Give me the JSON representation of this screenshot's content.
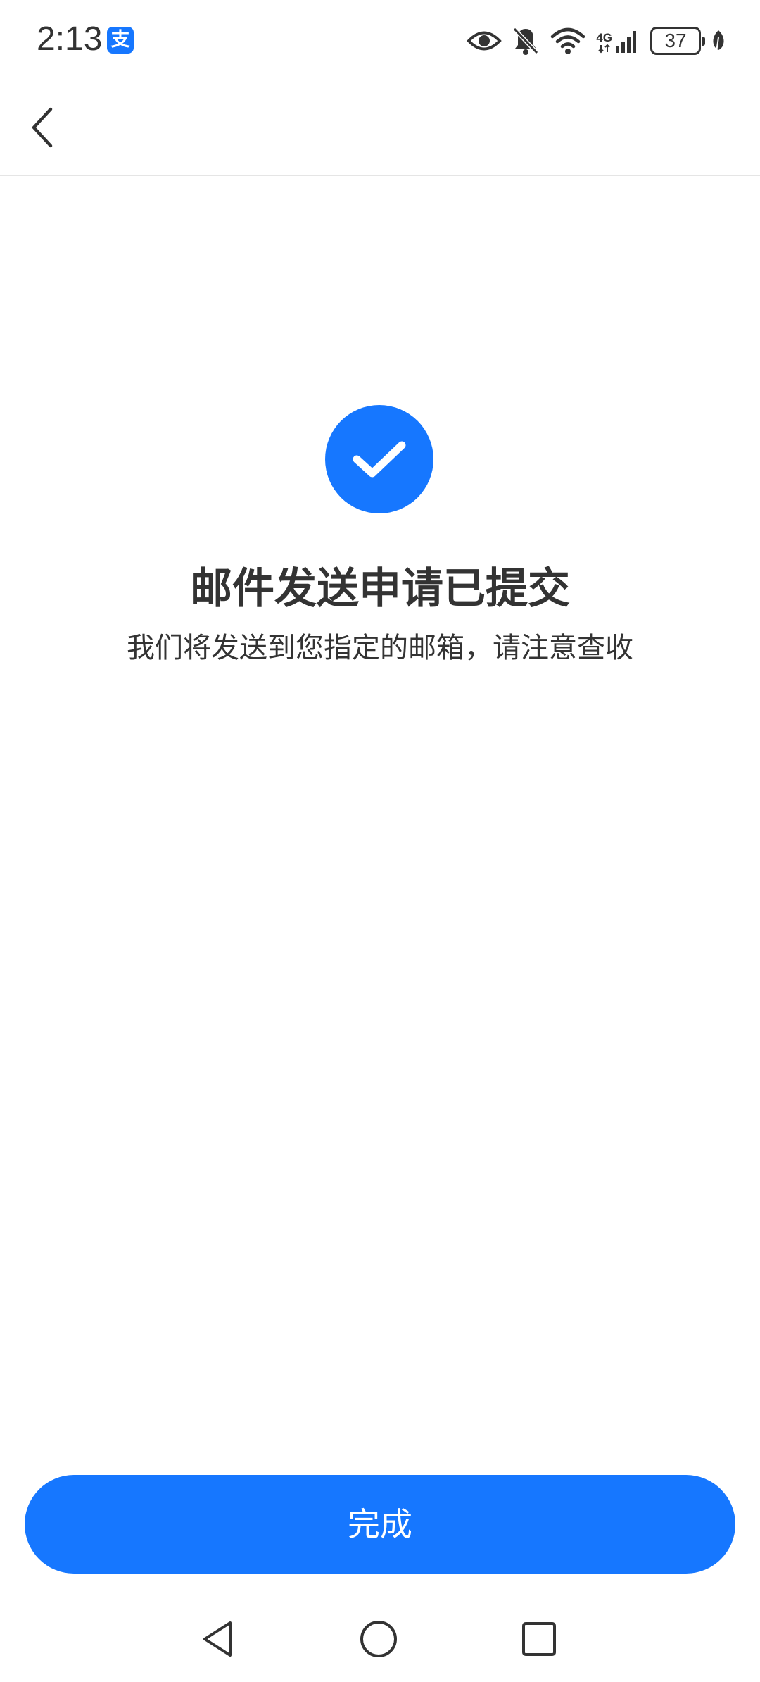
{
  "status_bar": {
    "time": "2:13",
    "app_badge": "支",
    "network_label": "4G",
    "battery_level": "37",
    "icons": [
      "eye-icon",
      "bell-off-icon",
      "wifi-icon",
      "signal-icon",
      "battery-icon",
      "leaf-icon"
    ]
  },
  "header": {
    "back_icon": "chevron-left-icon"
  },
  "main": {
    "status_icon": "check-circle-icon",
    "title": "邮件发送申请已提交",
    "description": "我们将发送到您指定的邮箱，请注意查收"
  },
  "footer": {
    "done_label": "完成"
  },
  "nav_bar": {
    "icons": [
      "back-triangle-icon",
      "home-circle-icon",
      "recents-square-icon"
    ]
  },
  "colors": {
    "accent": "#1677ff",
    "text": "#333333",
    "divider": "#e5e5e5",
    "background": "#ffffff"
  }
}
